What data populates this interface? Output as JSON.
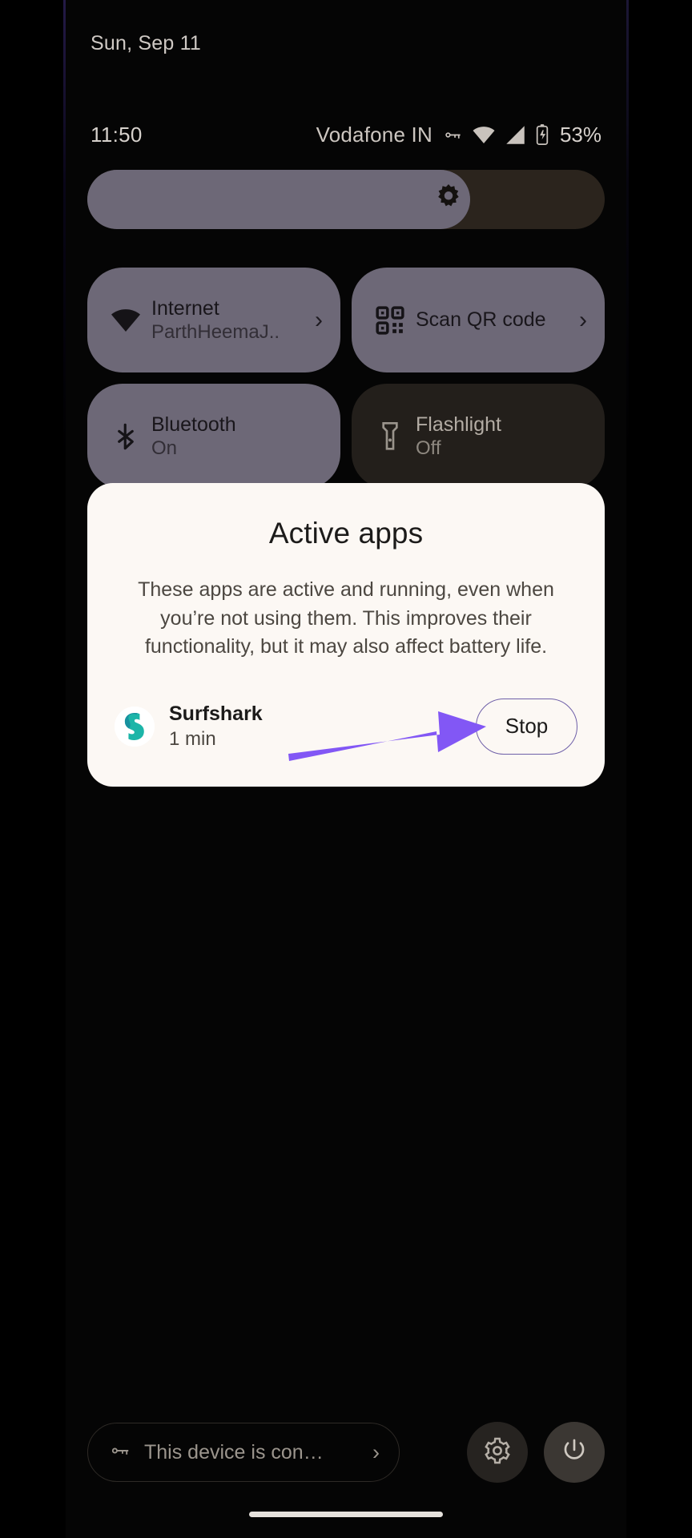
{
  "statusbar": {
    "date": "Sun, Sep 11",
    "clock": "11:50",
    "carrier": "Vodafone IN",
    "vpn_icon": "key-icon",
    "wifi_icon": "wifi-icon",
    "signal_icon": "cellular-signal-icon",
    "battery_icon": "battery-icon",
    "battery_percent": "53%"
  },
  "brightness": {
    "icon": "brightness-icon",
    "level_percent": 74,
    "fill_color": "#6d6877",
    "track_color": "#2b241d"
  },
  "tiles": [
    {
      "name": "internet",
      "icon": "wifi-icon",
      "label": "Internet",
      "sublabel": "ParthHeemaJ..",
      "state": "on",
      "chevron": "›"
    },
    {
      "name": "scan-qr-code",
      "icon": "qr-code-icon",
      "label": "Scan QR code",
      "sublabel": "",
      "state": "on",
      "chevron": "›"
    },
    {
      "name": "bluetooth",
      "icon": "bluetooth-icon",
      "label": "Bluetooth",
      "sublabel": "On",
      "state": "on",
      "chevron": ""
    },
    {
      "name": "flashlight",
      "icon": "flashlight-icon",
      "label": "Flashlight",
      "sublabel": "Off",
      "state": "off",
      "chevron": ""
    }
  ],
  "dialog": {
    "title": "Active apps",
    "body": "These apps are active and running, even when you’re not using them. This improves their functionality, but it may also affect battery life.",
    "app": {
      "icon": "surfshark-icon",
      "name": "Surfshark",
      "duration": "1 min",
      "stop_label": "Stop"
    },
    "background_color": "#fcf8f4",
    "stop_border_color": "#6e5fa8"
  },
  "annotation": {
    "arrow_color": "#8257f5",
    "points_to": "stop-button"
  },
  "footer": {
    "device_management": {
      "icon": "key-icon",
      "text": "This device is con…",
      "chevron": "›"
    },
    "settings_icon": "gear-icon",
    "power_icon": "power-icon"
  }
}
